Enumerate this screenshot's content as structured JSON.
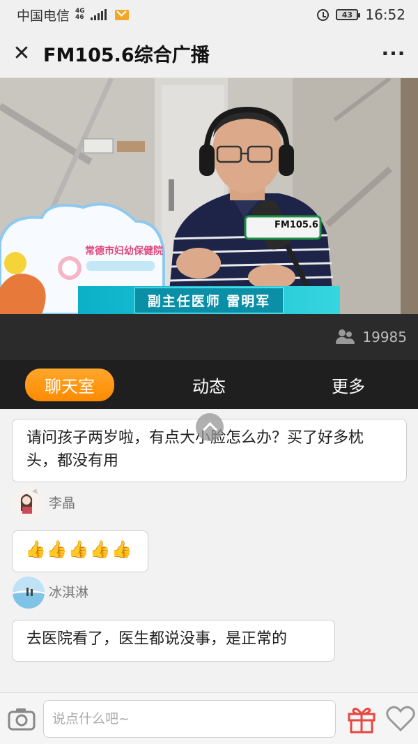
{
  "status_bar": {
    "carrier": "中国电信",
    "network_top": "4G",
    "network_bottom": "46",
    "battery": "43",
    "time": "16:52"
  },
  "header": {
    "close_symbol": "✕",
    "title": "FM105.6综合广播",
    "more_symbol": "···"
  },
  "video": {
    "caption": "副主任医师  雷明军",
    "sign_text": "常德市妇幼保健院",
    "mic_badge": "FM105.6"
  },
  "viewers": {
    "count": "19985",
    "icon": "users-icon"
  },
  "tabs": [
    {
      "label": "聊天室",
      "active": true
    },
    {
      "label": "动态",
      "active": false
    },
    {
      "label": "更多",
      "active": false
    }
  ],
  "chat": {
    "messages": [
      {
        "text": "请问孩子两岁啦，有点大小脸怎么办？买了好多枕头，都没有用"
      },
      {
        "user": "李晶",
        "text": "👍👍👍👍👍"
      },
      {
        "user": "冰淇淋",
        "text": "去医院看了，医生都说没事，是正常的"
      }
    ]
  },
  "input_bar": {
    "placeholder": "说点什么吧~"
  },
  "colors": {
    "accent": "#ff9800",
    "caption": "#0bb0c8",
    "gift": "#e8473f"
  }
}
